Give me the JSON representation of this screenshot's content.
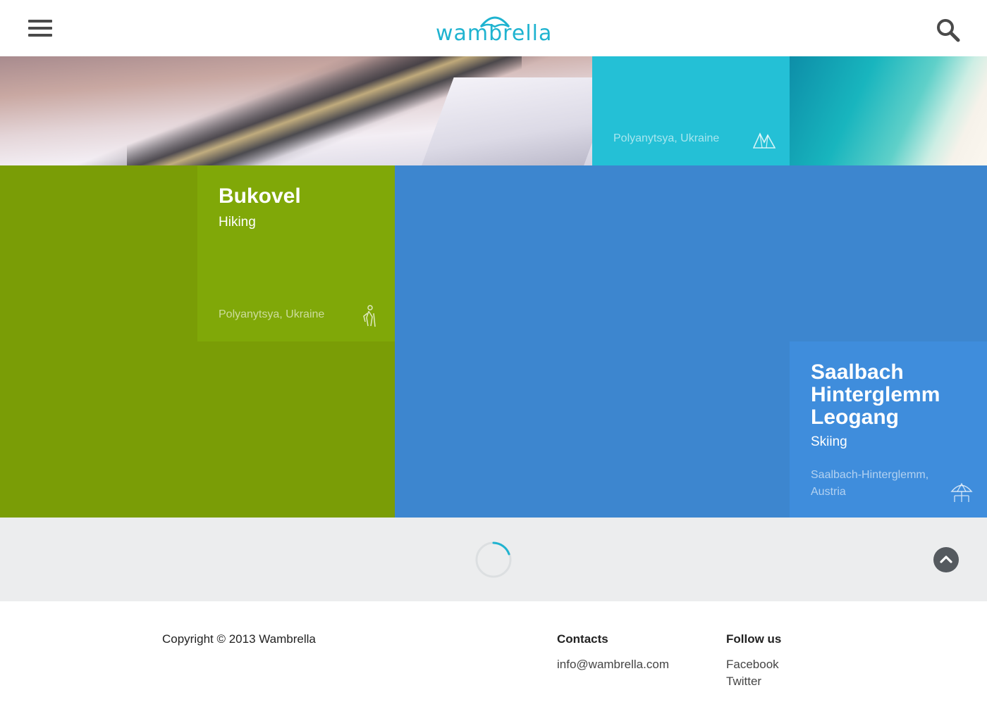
{
  "header": {
    "logo_text": "wambrella",
    "menu_icon": "hamburger-menu-icon",
    "search_icon": "search-icon"
  },
  "tiles": {
    "teal": {
      "location": "Polyanytsya, Ukraine",
      "icon": "mountains-icon"
    },
    "bukovel": {
      "title": "Bukovel",
      "activity": "Hiking",
      "location": "Polyanytsya, Ukraine",
      "icon": "hiker-icon"
    },
    "saalbach": {
      "title": "Saalbach Hinterglemm Leogang",
      "activity": "Skiing",
      "location": "Saalbach-Hinterglemm, Austria",
      "icon": "beach-umbrella-icon"
    }
  },
  "footer": {
    "copyright": "Copyright © 2013 Wambrella",
    "contacts_heading": "Contacts",
    "email": "info@wambrella.com",
    "follow_heading": "Follow us",
    "links": [
      "Facebook",
      "Twitter"
    ]
  },
  "colors": {
    "brand": "#1fb3d0",
    "teal_tile": "#24c0d6",
    "green_tile": "#7a9d06",
    "green_card": "#80a808",
    "blue_tile": "#3d86cf",
    "blue_card": "#3f8ddc"
  }
}
